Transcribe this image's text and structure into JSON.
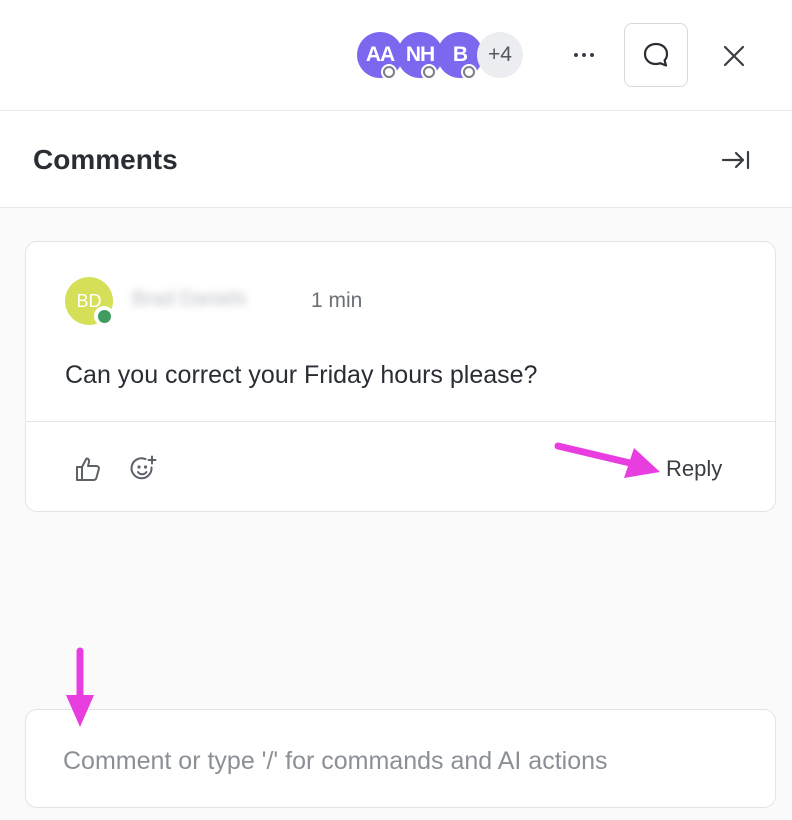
{
  "topbar": {
    "avatars": [
      {
        "initials": "AA",
        "color": "#7b68ee"
      },
      {
        "initials": "NH",
        "color": "#7b68ee"
      },
      {
        "initials": "B",
        "color": "#7b68ee"
      }
    ],
    "more_count": "+4",
    "icons": {
      "more": "more-dots-icon",
      "chat": "chat-bubble-icon",
      "close": "close-icon"
    }
  },
  "panel": {
    "title": "Comments",
    "collapse_icon": "collapse-right-icon"
  },
  "comment": {
    "author_initials": "BD",
    "author_name": "Brad Daniels",
    "author_color": "#d5df58",
    "status_color": "#3f9b5e",
    "time": "1 min",
    "text": "Can you correct your Friday hours please?",
    "reply_label": "Reply",
    "icons": {
      "like": "thumbs-up-icon",
      "reaction": "add-reaction-icon"
    }
  },
  "composer": {
    "placeholder": "Comment or type '/' for commands and AI actions"
  },
  "annotations": {
    "arrow_color": "#e83ee0"
  }
}
